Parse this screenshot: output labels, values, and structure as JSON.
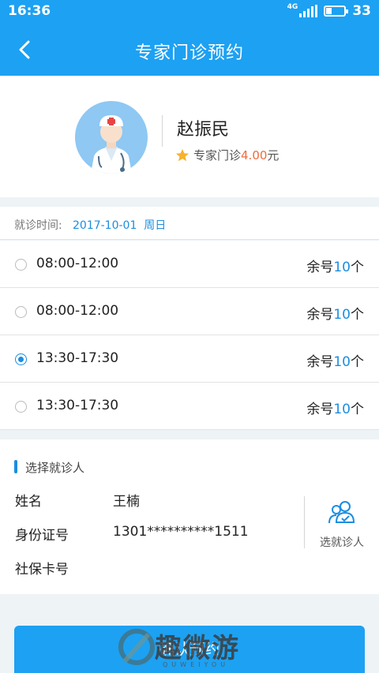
{
  "status_bar": {
    "time": "16:36",
    "network": "4G",
    "battery": "33",
    "battery_level": 0.33
  },
  "nav": {
    "title": "专家门诊预约"
  },
  "doctor": {
    "name": "赵振民",
    "type_label": "专家门诊",
    "price": "4.00",
    "currency": "元"
  },
  "schedule": {
    "date_label": "就诊时间:",
    "date_value": "2017-10-01  周日",
    "slots": [
      {
        "time": "08:00-12:00",
        "remain_prefix": "余号",
        "remain_count": "10",
        "remain_suffix": "个",
        "selected": false
      },
      {
        "time": "08:00-12:00",
        "remain_prefix": "余号",
        "remain_count": "10",
        "remain_suffix": "个",
        "selected": false
      },
      {
        "time": "13:30-17:30",
        "remain_prefix": "余号",
        "remain_count": "10",
        "remain_suffix": "个",
        "selected": true
      },
      {
        "time": "13:30-17:30",
        "remain_prefix": "余号",
        "remain_count": "10",
        "remain_suffix": "个",
        "selected": false
      }
    ]
  },
  "patient": {
    "section_title": "选择就诊人",
    "name_label": "姓名",
    "name_value": "王楠",
    "id_label": "身份证号",
    "id_value": "1301**********1511",
    "insurance_label": "社保卡号",
    "choose_label": "选就诊人"
  },
  "confirm_label": "确认预约",
  "watermark": {
    "text": "趣微游",
    "subtext": "QUWEIYOU"
  },
  "colors": {
    "primary": "#1da1f2",
    "accent": "#1a8ee0",
    "price": "#f06a3c"
  }
}
